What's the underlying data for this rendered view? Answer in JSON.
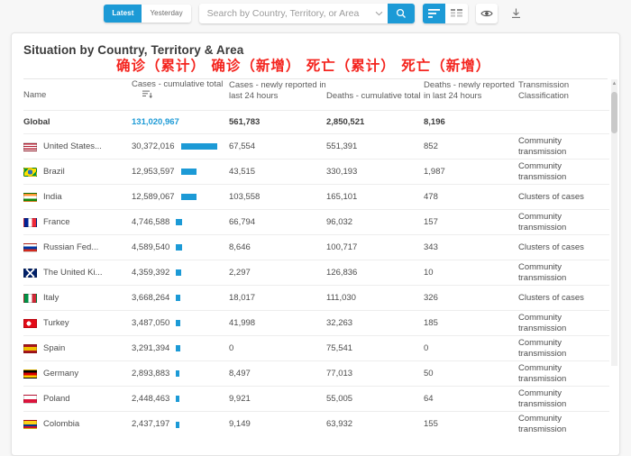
{
  "toolbar": {
    "latest_label": "Latest",
    "yesterday_label": "Yesterday",
    "search_placeholder": "Search by Country, Territory, or Area",
    "chevron_icon": "chevron-down-icon",
    "search_icon": "search-icon",
    "list_view_icon": "list-view-icon",
    "grid_view_icon": "grid-view-icon",
    "visibility_icon": "eye-icon",
    "download_icon": "download-icon",
    "accent_color": "#1c9ad6"
  },
  "card": {
    "title": "Situation by Country, Territory & Area",
    "annotation": "确诊（累计） 确诊（新增） 死亡（累计） 死亡（新增）",
    "annotation_color": "#f4241e"
  },
  "table": {
    "columns": [
      "Name",
      "Cases - cumulative total",
      "Cases - newly reported in last 24 hours",
      "Deaths - cumulative total",
      "Deaths - newly reported in last 24 hours",
      "Transmission Classification"
    ],
    "sort_icon": "sort-descending-icon",
    "global": {
      "name": "Global",
      "cases_total": "131,020,967",
      "cases_new": "561,783",
      "deaths_total": "2,850,521",
      "deaths_new": "8,196",
      "transmission": ""
    },
    "rows": [
      {
        "name": "United States...",
        "flag": "us",
        "cases_total": "30,372,016",
        "bar": 40,
        "cases_new": "67,554",
        "deaths_total": "551,391",
        "deaths_new": "852",
        "transmission": "Community transmission"
      },
      {
        "name": "Brazil",
        "flag": "br",
        "cases_total": "12,953,597",
        "bar": 17,
        "cases_new": "43,515",
        "deaths_total": "330,193",
        "deaths_new": "1,987",
        "transmission": "Community transmission"
      },
      {
        "name": "India",
        "flag": "in",
        "cases_total": "12,589,067",
        "bar": 17,
        "cases_new": "103,558",
        "deaths_total": "165,101",
        "deaths_new": "478",
        "transmission": "Clusters of cases"
      },
      {
        "name": "France",
        "flag": "fr",
        "cases_total": "4,746,588",
        "bar": 7,
        "cases_new": "66,794",
        "deaths_total": "96,032",
        "deaths_new": "157",
        "transmission": "Community transmission"
      },
      {
        "name": "Russian Fed...",
        "flag": "ru",
        "cases_total": "4,589,540",
        "bar": 7,
        "cases_new": "8,646",
        "deaths_total": "100,717",
        "deaths_new": "343",
        "transmission": "Clusters of cases"
      },
      {
        "name": "The United Ki...",
        "flag": "gb",
        "cases_total": "4,359,392",
        "bar": 6,
        "cases_new": "2,297",
        "deaths_total": "126,836",
        "deaths_new": "10",
        "transmission": "Community transmission"
      },
      {
        "name": "Italy",
        "flag": "it",
        "cases_total": "3,668,264",
        "bar": 5,
        "cases_new": "18,017",
        "deaths_total": "111,030",
        "deaths_new": "326",
        "transmission": "Clusters of cases"
      },
      {
        "name": "Turkey",
        "flag": "tr",
        "cases_total": "3,487,050",
        "bar": 5,
        "cases_new": "41,998",
        "deaths_total": "32,263",
        "deaths_new": "185",
        "transmission": "Community transmission"
      },
      {
        "name": "Spain",
        "flag": "es",
        "cases_total": "3,291,394",
        "bar": 5,
        "cases_new": "0",
        "deaths_total": "75,541",
        "deaths_new": "0",
        "transmission": "Community transmission"
      },
      {
        "name": "Germany",
        "flag": "de",
        "cases_total": "2,893,883",
        "bar": 4,
        "cases_new": "8,497",
        "deaths_total": "77,013",
        "deaths_new": "50",
        "transmission": "Community transmission"
      },
      {
        "name": "Poland",
        "flag": "pl",
        "cases_total": "2,448,463",
        "bar": 4,
        "cases_new": "9,921",
        "deaths_total": "55,005",
        "deaths_new": "64",
        "transmission": "Community transmission"
      },
      {
        "name": "Colombia",
        "flag": "co",
        "cases_total": "2,437,197",
        "bar": 4,
        "cases_new": "9,149",
        "deaths_total": "63,932",
        "deaths_new": "155",
        "transmission": "Community transmission"
      }
    ]
  }
}
